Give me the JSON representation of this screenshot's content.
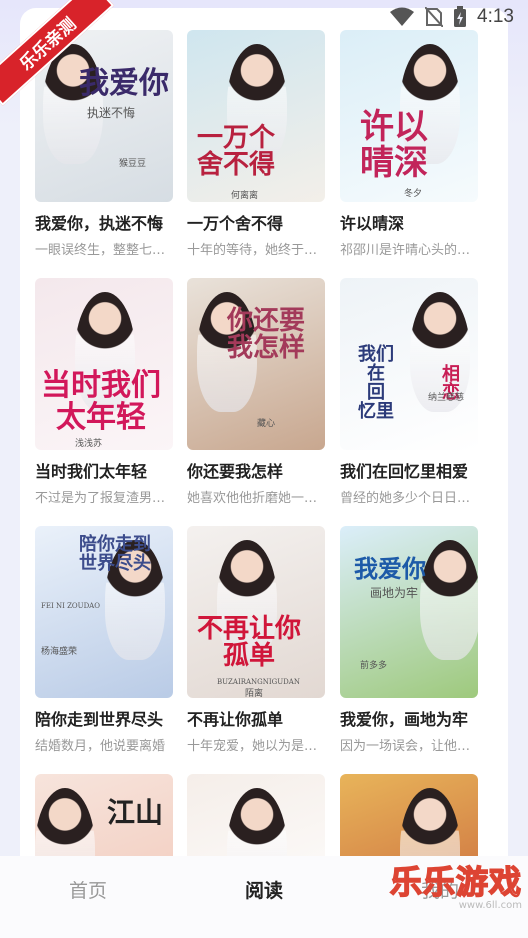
{
  "status": {
    "time": "4:13"
  },
  "badge": "乐乐亲测",
  "watermark": {
    "main": "乐乐游戏",
    "url": "www.6ll.com"
  },
  "books": [
    {
      "title": "我爱你，执迷不悔",
      "desc": "一眼误终生，整整七年的时光",
      "cover_title": "我爱你",
      "cover_sub": "执迷不悔",
      "cover_author": "猴豆豆",
      "colors": [
        "#f0f2f4",
        "#d6dde3"
      ]
    },
    {
      "title": "一万个舍不得",
      "desc": "十年的等待，她终于等到了他",
      "cover_title": "一万个\n舍不得",
      "cover_sub": "",
      "cover_author": "何离离",
      "colors": [
        "#cfe6ef",
        "#f3efe9"
      ]
    },
    {
      "title": "许以晴深",
      "desc": "祁邵川是许晴心头的一根刺",
      "cover_title": "许以\n晴深",
      "cover_sub": "",
      "cover_author": "冬夕",
      "colors": [
        "#dbeef7",
        "#f6fbfd"
      ]
    },
    {
      "title": "当时我们太年轻",
      "desc": "不过是为了报复渣男而已",
      "cover_title": "当时我们\n太年轻",
      "cover_sub": "",
      "cover_author": "浅浅苏",
      "colors": [
        "#f4e8ec",
        "#fbf5f7"
      ]
    },
    {
      "title": "你还要我怎样",
      "desc": "她喜欢他他折磨她一辈子",
      "cover_title": "你还要\n我怎样",
      "cover_sub": "",
      "cover_author": "藏心",
      "colors": [
        "#e9e2da",
        "#c8a78f"
      ]
    },
    {
      "title": "我们在回忆里相爱",
      "desc": "曾经的她多少个日日夜夜",
      "cover_title": "我们\n在\n回\n忆里",
      "cover_sub": "相恋",
      "cover_author": "纳兰慈慈",
      "colors": [
        "#eef3f7",
        "#ffffff"
      ]
    },
    {
      "title": "陪你走到世界尽头",
      "desc": "结婚数月，他说要离婚",
      "cover_title": "陪你走到\n世界尽头",
      "cover_sub": "FEI NI ZOUDAO",
      "cover_author": "杨海盛荣",
      "colors": [
        "#eaf1fa",
        "#b9cbe6"
      ]
    },
    {
      "title": "不再让你孤单",
      "desc": "十年宠爱，她以为是爱情",
      "cover_title": "不再让你\n孤单",
      "cover_sub": "BUZAIRANGNIGUDAN",
      "cover_author": "陌离",
      "colors": [
        "#f4f1ef",
        "#e2d8d2"
      ]
    },
    {
      "title": "我爱你，画地为牢",
      "desc": "因为一场误会，让他们错过",
      "cover_title": "我爱你",
      "cover_sub": "画地为牢",
      "cover_author": "前多多",
      "colors": [
        "#dbeefa",
        "#9ec97c"
      ]
    },
    {
      "title": "",
      "desc": "",
      "cover_title": "江山",
      "cover_sub": "",
      "cover_author": "",
      "colors": [
        "#f7e4dc",
        "#f1c7b8"
      ]
    },
    {
      "title": "",
      "desc": "",
      "cover_title": "",
      "cover_sub": "",
      "cover_author": "",
      "colors": [
        "#f5eee9",
        "#ffffff"
      ]
    },
    {
      "title": "",
      "desc": "",
      "cover_title": "",
      "cover_sub": "",
      "cover_author": "",
      "colors": [
        "#e8b45a",
        "#c7623a"
      ]
    }
  ],
  "tabs": [
    {
      "label": "首页",
      "active": false
    },
    {
      "label": "阅读",
      "active": true
    },
    {
      "label": "我的",
      "active": false
    }
  ]
}
